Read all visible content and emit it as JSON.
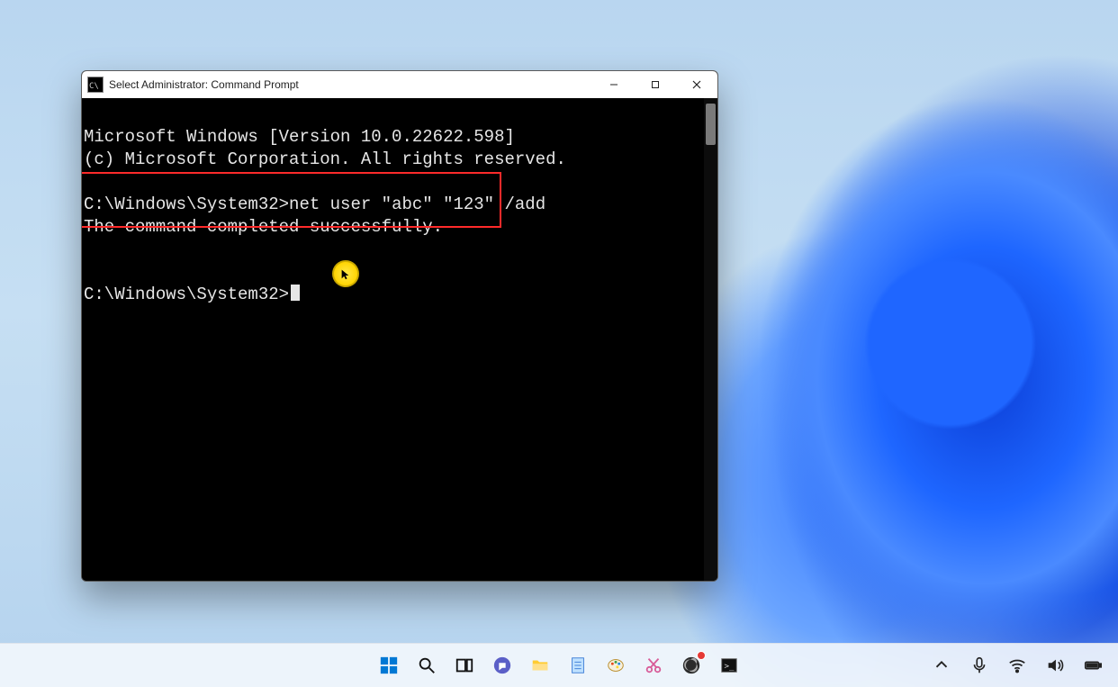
{
  "window": {
    "title": "Select Administrator: Command Prompt",
    "icon_label": "C:\\",
    "controls": {
      "minimize": "—",
      "maximize": "☐",
      "close": "✕"
    }
  },
  "terminal": {
    "line1": "Microsoft Windows [Version 10.0.22622.598]",
    "line2": "(c) Microsoft Corporation. All rights reserved.",
    "blank1": "",
    "prompt1_path": "C:\\Windows\\System32>",
    "prompt1_cmd": "net user \"abc\" \"123\" /add",
    "result1": "The command completed successfully.",
    "blank2": "",
    "blank3": "",
    "prompt2_path": "C:\\Windows\\System32>"
  },
  "taskbar": {
    "items": [
      {
        "name": "start-button"
      },
      {
        "name": "search-button"
      },
      {
        "name": "task-view-button"
      },
      {
        "name": "chat-button"
      },
      {
        "name": "file-explorer-button"
      },
      {
        "name": "notepad-button"
      },
      {
        "name": "paint-button"
      },
      {
        "name": "snipping-tool-button"
      },
      {
        "name": "obs-button"
      },
      {
        "name": "command-prompt-button"
      }
    ],
    "tray": [
      {
        "name": "overflow-icon"
      },
      {
        "name": "microphone-icon"
      },
      {
        "name": "wifi-icon"
      },
      {
        "name": "volume-icon"
      },
      {
        "name": "battery-icon"
      }
    ]
  }
}
